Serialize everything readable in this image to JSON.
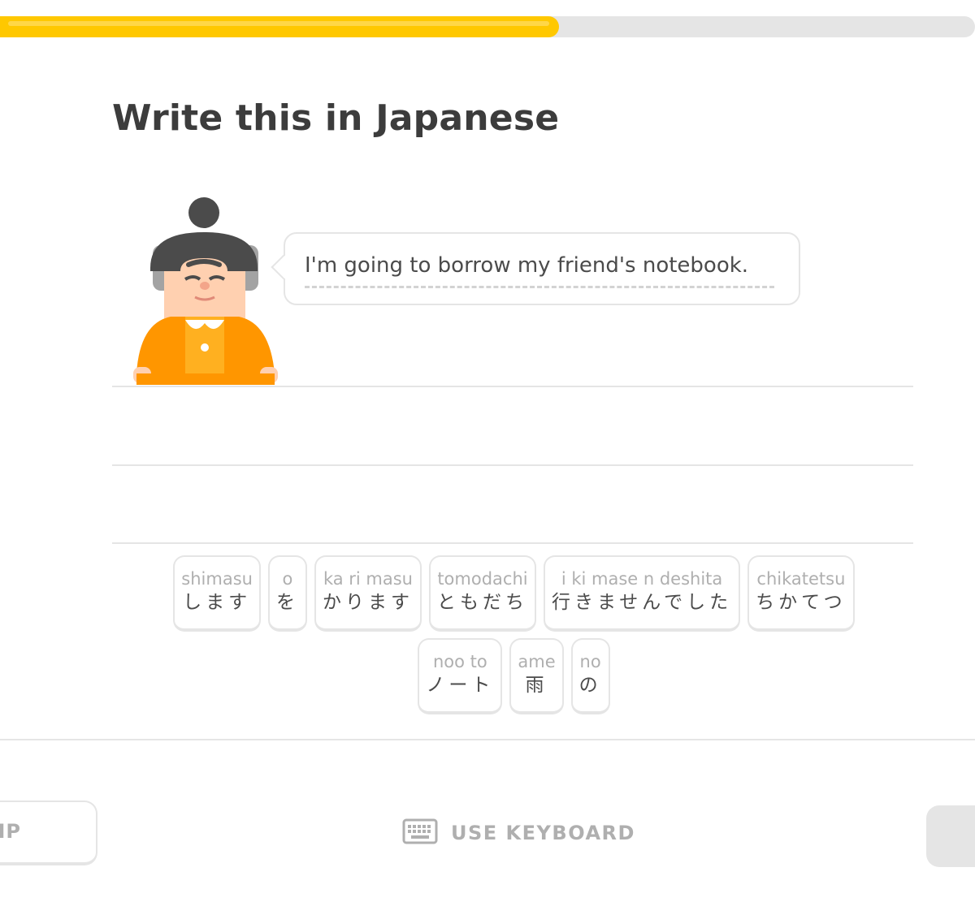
{
  "progress": {
    "value": 0.573,
    "fill_color": "#ffc800",
    "track_color": "#e5e5e5"
  },
  "challenge": {
    "title": "Write this in Japanese",
    "character": "character-avatar",
    "prompt": "I'm going to borrow my friend's notebook."
  },
  "word_bank": [
    {
      "romaji": "shimasu",
      "kana": "します"
    },
    {
      "romaji": "o",
      "kana": "を"
    },
    {
      "romaji": "ka ri masu",
      "kana": "かります"
    },
    {
      "romaji": "tomodachi",
      "kana": "ともだち"
    },
    {
      "romaji": "i  ki mase n deshita",
      "kana": "行きませんでした"
    },
    {
      "romaji": "chikatetsu",
      "kana": "ちかてつ"
    },
    {
      "romaji": "noo to",
      "kana": "ノート"
    },
    {
      "romaji": "ame",
      "kana": "雨"
    },
    {
      "romaji": "no",
      "kana": "の"
    }
  ],
  "footer": {
    "skip_label": "IP",
    "keyboard_label": "USE KEYBOARD",
    "keyboard_icon": "keyboard-icon"
  }
}
